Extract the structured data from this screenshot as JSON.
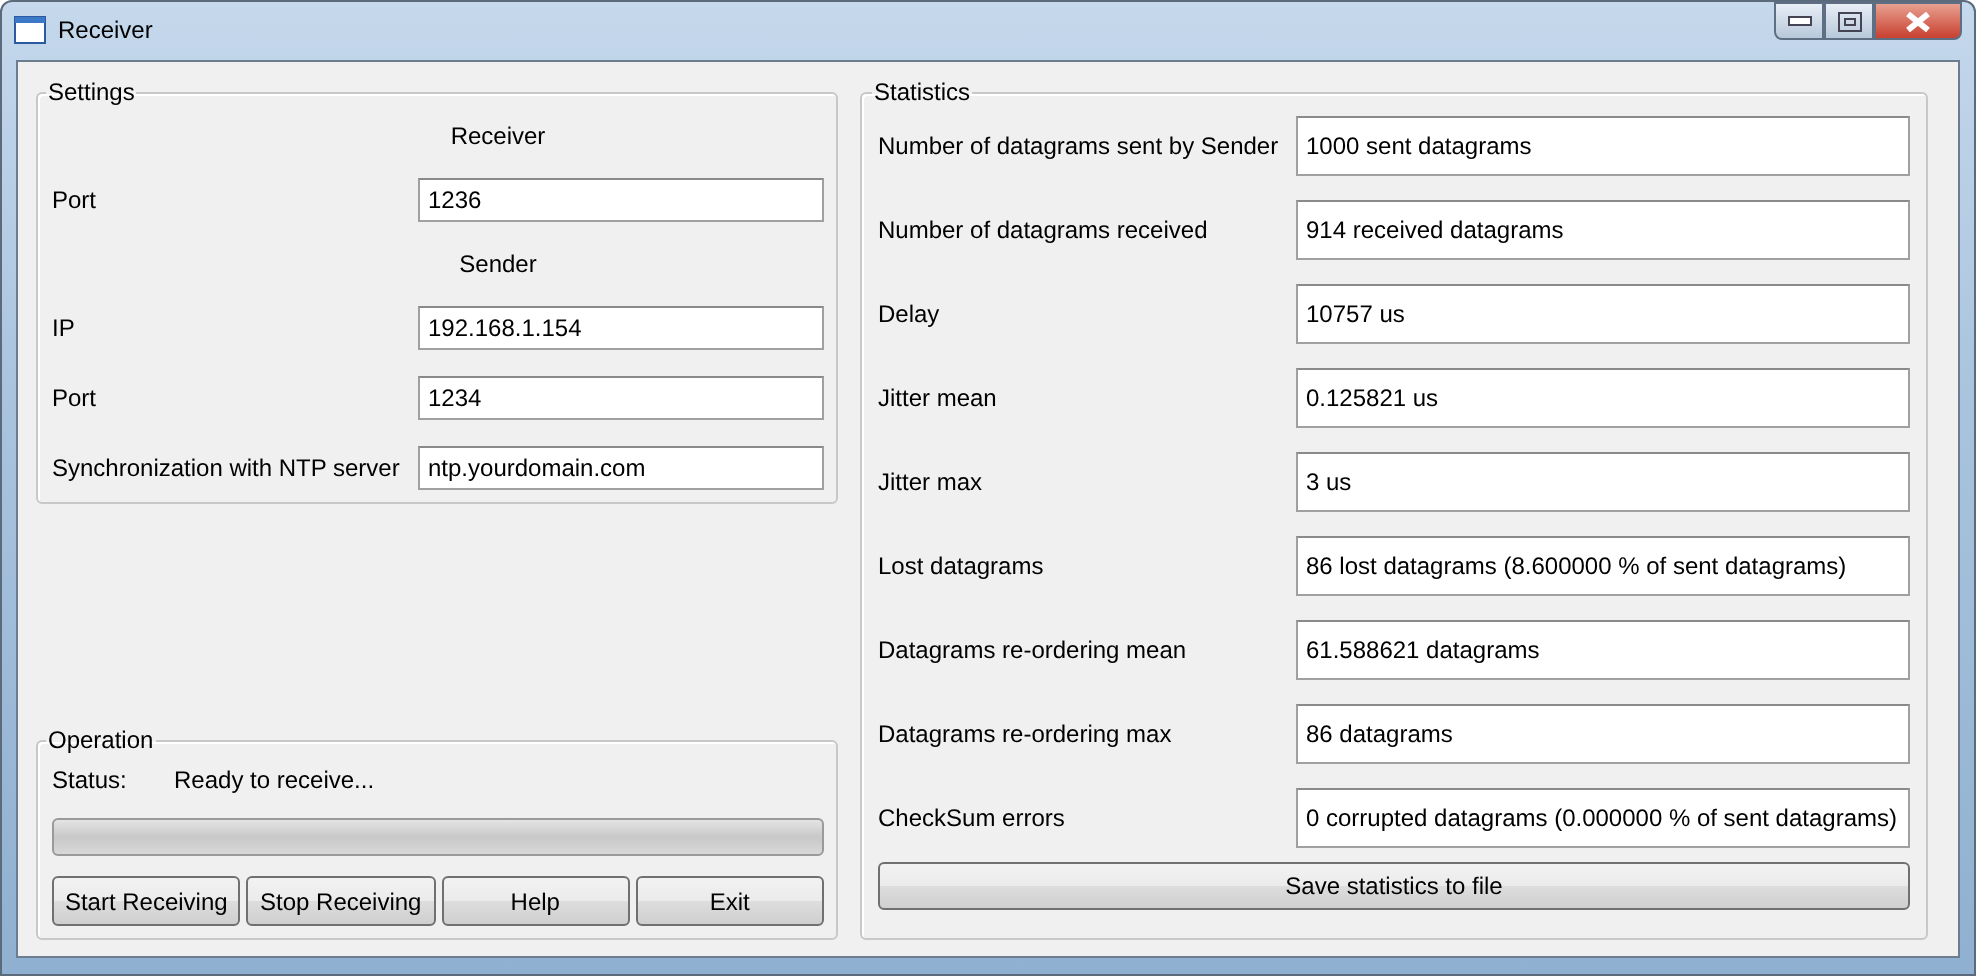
{
  "window": {
    "title": "Receiver"
  },
  "settings": {
    "title": "Settings",
    "items": [
      {
        "kind": "heading",
        "text": "Receiver"
      },
      {
        "kind": "field",
        "label": "Port",
        "value": "1236"
      },
      {
        "kind": "heading",
        "text": "Sender"
      },
      {
        "kind": "field",
        "label": "IP",
        "value": "192.168.1.154"
      },
      {
        "kind": "field",
        "label": "Port",
        "value": "1234"
      },
      {
        "kind": "field",
        "label": "Synchronization with NTP server",
        "value": "ntp.yourdomain.com"
      }
    ]
  },
  "operation": {
    "title": "Operation",
    "status_label": "Status:",
    "status": "Ready to receive...",
    "progress": {
      "level": 0
    },
    "buttons": [
      "Start Receiving",
      "Stop Receiving",
      "Help",
      "Exit"
    ]
  },
  "statistics": {
    "title": "Statistics",
    "rows": [
      {
        "label": "Number of datagrams sent by Sender",
        "value": "1000 sent datagrams"
      },
      {
        "label": "Number of datagrams received",
        "value": "914 received datagrams"
      },
      {
        "label": "Delay",
        "value": "10757 us"
      },
      {
        "label": "Jitter mean",
        "value": "0.125821 us"
      },
      {
        "label": "Jitter max",
        "value": "3 us"
      },
      {
        "label": "Lost datagrams",
        "value": "86 lost datagrams (8.600000 % of sent datagrams)"
      },
      {
        "label": "Datagrams re-ordering mean",
        "value": "61.588621 datagrams"
      },
      {
        "label": "Datagrams re-ordering max",
        "value": "86 datagrams"
      },
      {
        "label": "CheckSum errors",
        "value": "0 corrupted datagrams (0.000000 % of sent datagrams)"
      }
    ],
    "button": "Save statistics to file"
  }
}
